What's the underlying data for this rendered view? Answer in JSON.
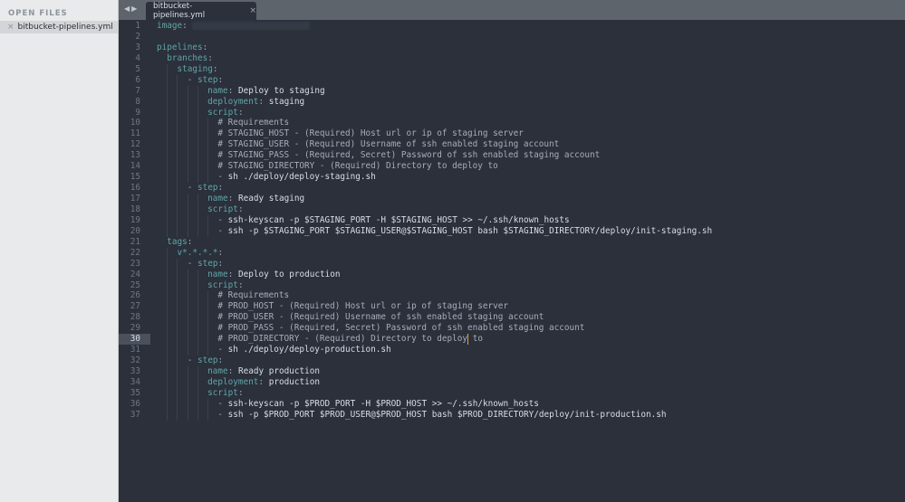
{
  "sidebar": {
    "header": "OPEN FILES",
    "files": [
      {
        "name": "bitbucket-pipelines.yml"
      }
    ]
  },
  "tabbar": {
    "tabs": [
      {
        "label": "bitbucket-pipelines.yml",
        "active": true
      }
    ]
  },
  "editor": {
    "current_line": 30,
    "cursor": {
      "line": 30,
      "after_text": "# PROD_DIRECTORY - (Required) Directory to deploy"
    },
    "colors": {
      "background": "#2b303b",
      "key": "#5fa6a8",
      "text": "#d8dee9",
      "comment": "#a7adba",
      "caret": "#f0a030"
    },
    "lines": [
      {
        "n": "1",
        "indent": 0,
        "key": "image",
        "redacted": true
      },
      {
        "n": "2",
        "indent": 0
      },
      {
        "n": "3",
        "indent": 0,
        "key": "pipelines"
      },
      {
        "n": "4",
        "indent": 2,
        "key": "branches"
      },
      {
        "n": "5",
        "indent": 4,
        "key": "staging"
      },
      {
        "n": "6",
        "indent": 6,
        "dash": true,
        "key": "step"
      },
      {
        "n": "7",
        "indent": 10,
        "key": "name",
        "value": "Deploy to staging"
      },
      {
        "n": "8",
        "indent": 10,
        "key": "deployment",
        "value": "staging"
      },
      {
        "n": "9",
        "indent": 10,
        "key": "script"
      },
      {
        "n": "10",
        "indent": 12,
        "comment": "# Requirements"
      },
      {
        "n": "11",
        "indent": 12,
        "comment": "# STAGING_HOST - (Required) Host url or ip of staging server"
      },
      {
        "n": "12",
        "indent": 12,
        "comment": "# STAGING_USER - (Required) Username of ssh enabled staging account"
      },
      {
        "n": "13",
        "indent": 12,
        "comment": "# STAGING_PASS - (Required, Secret) Password of ssh enabled staging account"
      },
      {
        "n": "14",
        "indent": 12,
        "comment": "# STAGING_DIRECTORY - (Required) Directory to deploy to"
      },
      {
        "n": "15",
        "indent": 12,
        "dash": true,
        "text": "sh ./deploy/deploy-staging.sh"
      },
      {
        "n": "16",
        "indent": 6,
        "dash": true,
        "key": "step"
      },
      {
        "n": "17",
        "indent": 10,
        "key": "name",
        "value": "Ready staging"
      },
      {
        "n": "18",
        "indent": 10,
        "key": "script"
      },
      {
        "n": "19",
        "indent": 12,
        "dash": true,
        "text": "ssh-keyscan -p $STAGING_PORT -H $STAGING_HOST >> ~/.ssh/known_hosts"
      },
      {
        "n": "20",
        "indent": 12,
        "dash": true,
        "text": "ssh -p $STAGING_PORT $STAGING_USER@$STAGING_HOST bash $STAGING_DIRECTORY/deploy/init-staging.sh"
      },
      {
        "n": "21",
        "indent": 2,
        "key": "tags"
      },
      {
        "n": "22",
        "indent": 4,
        "key": "v*.*.*.*"
      },
      {
        "n": "23",
        "indent": 6,
        "dash": true,
        "key": "step"
      },
      {
        "n": "24",
        "indent": 10,
        "key": "name",
        "value": "Deploy to production"
      },
      {
        "n": "25",
        "indent": 10,
        "key": "script"
      },
      {
        "n": "26",
        "indent": 12,
        "comment": "# Requirements"
      },
      {
        "n": "27",
        "indent": 12,
        "comment": "# PROD_HOST - (Required) Host url or ip of staging server"
      },
      {
        "n": "28",
        "indent": 12,
        "comment": "# PROD_USER - (Required) Username of ssh enabled staging account"
      },
      {
        "n": "29",
        "indent": 12,
        "comment": "# PROD_PASS - (Required, Secret) Password of ssh enabled staging account"
      },
      {
        "n": "30",
        "indent": 12,
        "comment": "# PROD_DIRECTORY - (Required) Directory to deploy",
        "comment_after_cursor": " to"
      },
      {
        "n": "31",
        "indent": 12,
        "dash": true,
        "text": "sh ./deploy/deploy-production.sh"
      },
      {
        "n": "32",
        "indent": 6,
        "dash": true,
        "key": "step"
      },
      {
        "n": "33",
        "indent": 10,
        "key": "name",
        "value": "Ready production"
      },
      {
        "n": "34",
        "indent": 10,
        "key": "deployment",
        "value": "production"
      },
      {
        "n": "35",
        "indent": 10,
        "key": "script"
      },
      {
        "n": "36",
        "indent": 12,
        "dash": true,
        "text": "ssh-keyscan -p $PROD_PORT -H $PROD_HOST >> ~/.ssh/known_hosts"
      },
      {
        "n": "37",
        "indent": 12,
        "dash": true,
        "text": "ssh -p $PROD_PORT $PROD_USER@$PROD_HOST bash $PROD_DIRECTORY/deploy/init-production.sh"
      }
    ]
  }
}
